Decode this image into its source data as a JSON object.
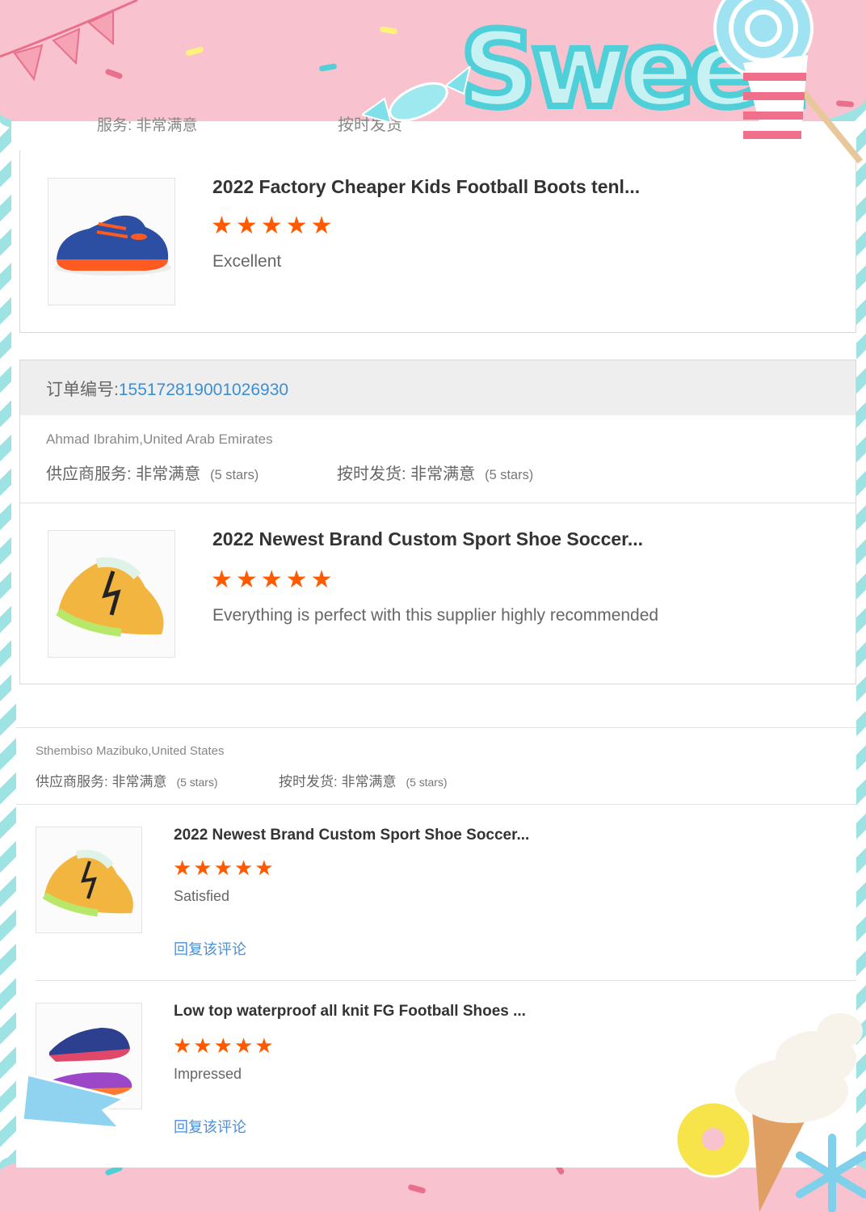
{
  "header": {
    "partial_meta_left": "服务: 非常满意",
    "partial_meta_right": "按时发货"
  },
  "decor": {
    "title": "Sweet",
    "colors": {
      "pink": "#f9c2cf",
      "teal": "#4fd0d8",
      "star": "#ff5a00",
      "link": "#3a8fd6"
    }
  },
  "card1": {
    "product": {
      "title": "2022 Factory Cheaper Kids Football Boots tenl...",
      "stars": "★★★★★",
      "rating": 5,
      "review": "Excellent",
      "thumb_icon": "blue-kids-football-boot-icon"
    }
  },
  "card2": {
    "order_label": "订单编号:",
    "order_number": "155172819001026930",
    "buyer": "Ahmad Ibrahim,United Arab Emirates",
    "supplier_service": "供应商服务: 非常满意",
    "supplier_service_stars": "(5 stars)",
    "on_time": "按时发货: 非常满意",
    "on_time_stars": "(5 stars)",
    "product": {
      "title": "2022 Newest Brand Custom Sport Shoe Soccer...",
      "stars": "★★★★★",
      "rating": 5,
      "review": "Everything is perfect with this supplier highly recommended",
      "thumb_icon": "yellow-soccer-cleat-icon"
    }
  },
  "card3": {
    "buyer": "Sthembiso Mazibuko,United States",
    "supplier_service": "供应商服务: 非常满意",
    "supplier_service_stars": "(5 stars)",
    "on_time": "按时发货: 非常满意",
    "on_time_stars": "(5 stars)",
    "products": [
      {
        "title": "2022 Newest Brand Custom Sport Shoe Soccer...",
        "stars": "★★★★★",
        "rating": 5,
        "review": "Satisfied",
        "reply": "回复该评论",
        "thumb_icon": "yellow-soccer-cleat-icon"
      },
      {
        "title": "Low top waterproof all knit FG Football Shoes ...",
        "stars": "★★★★★",
        "rating": 5,
        "review": "Impressed",
        "reply": "回复该评论",
        "thumb_icon": "purple-football-shoe-icon"
      }
    ]
  }
}
